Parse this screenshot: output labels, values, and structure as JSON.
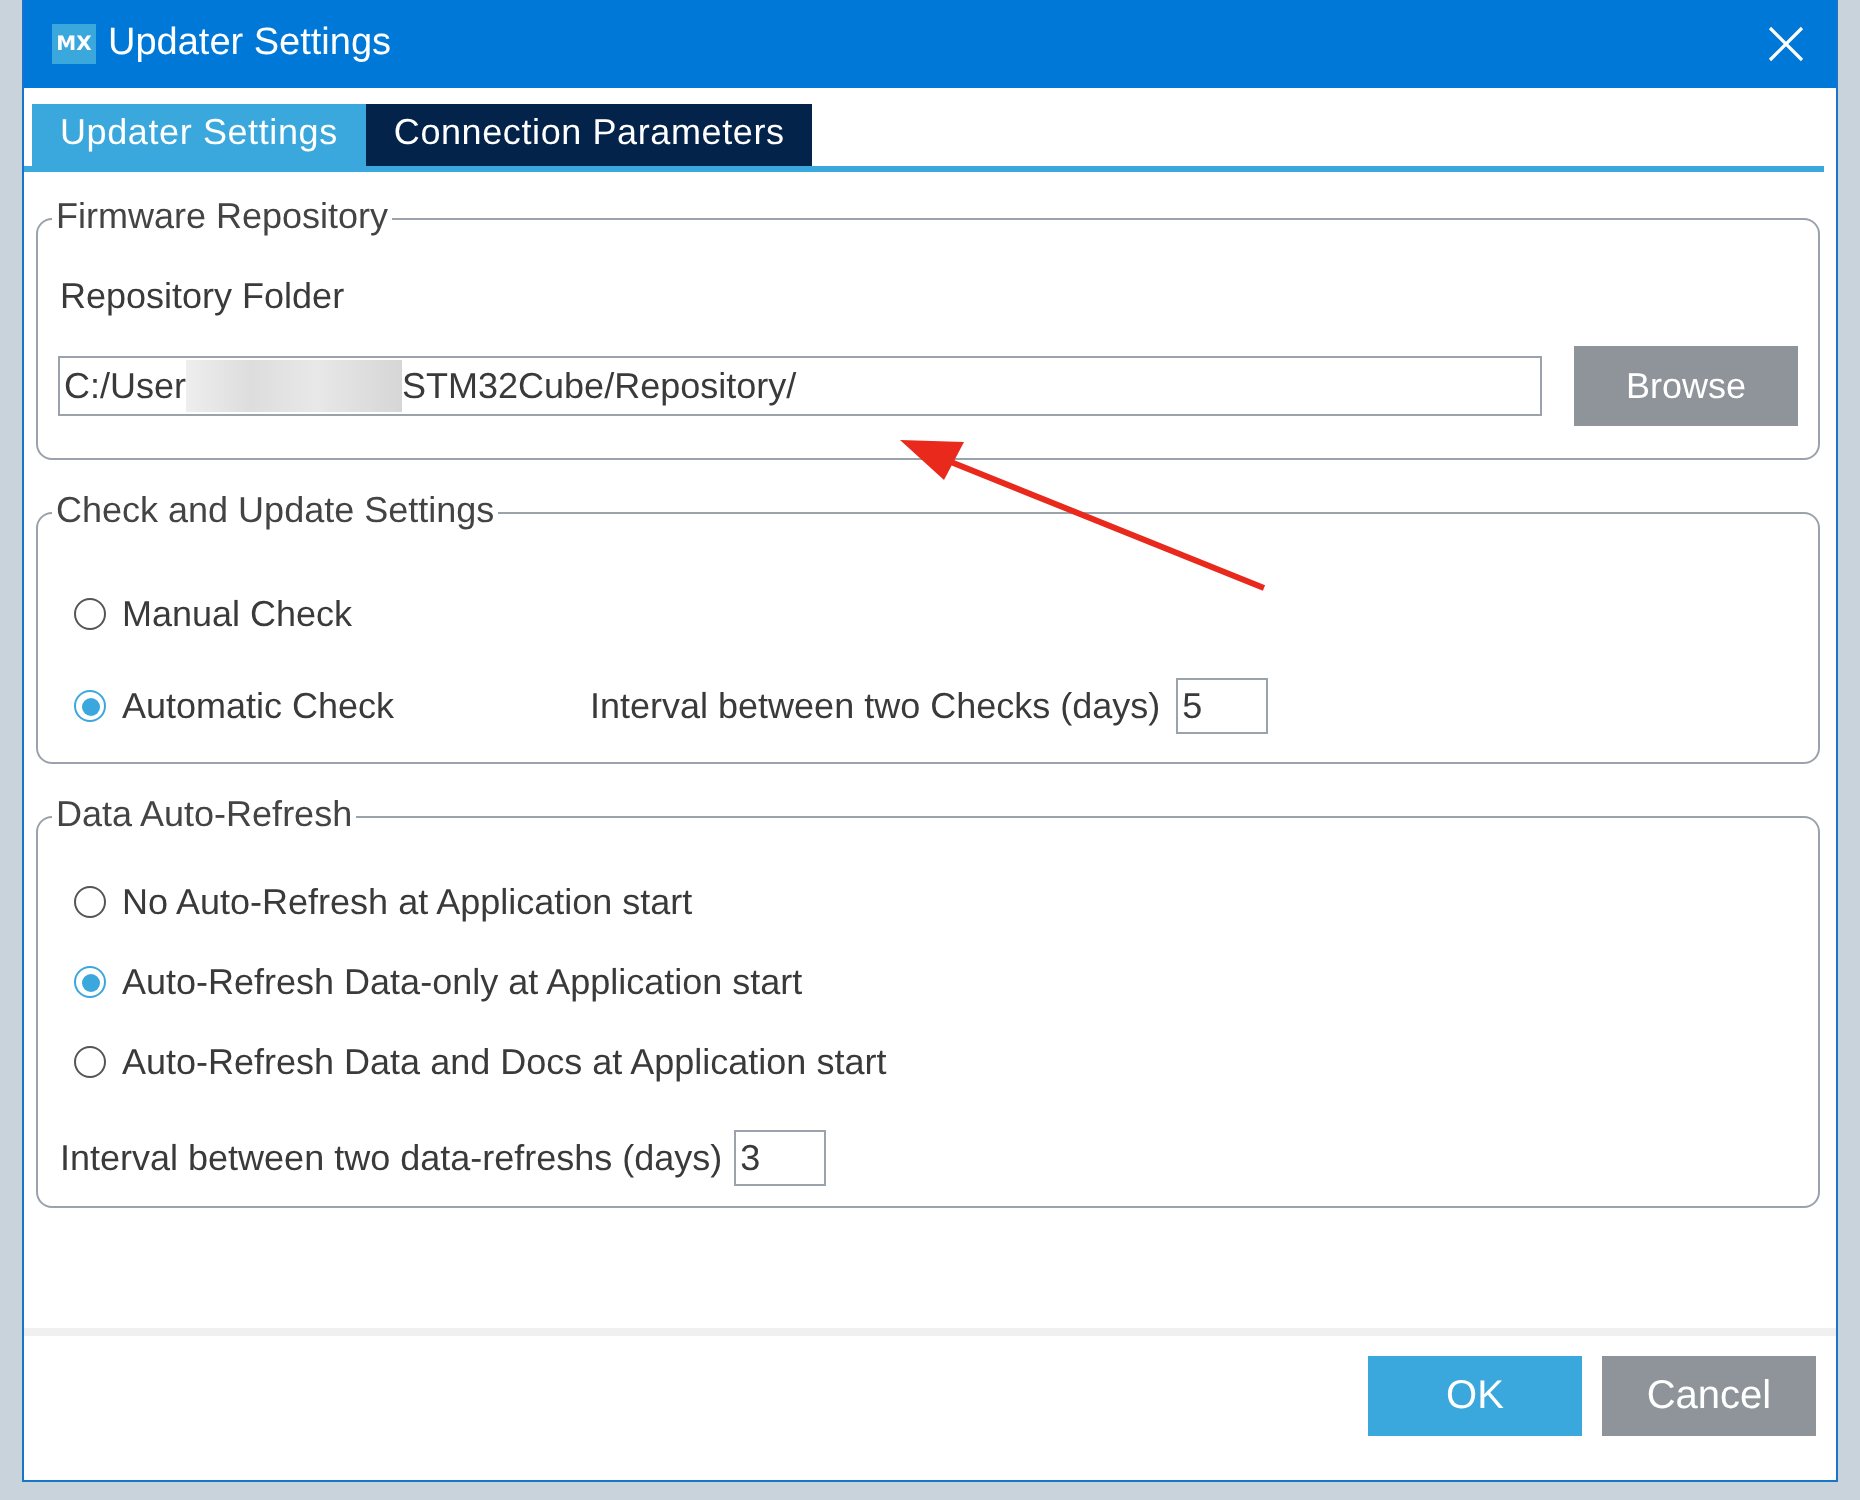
{
  "window": {
    "logo": "MX",
    "title": "Updater Settings"
  },
  "tabs": [
    {
      "label": "Updater Settings",
      "selected": true
    },
    {
      "label": "Connection Parameters",
      "selected": false
    }
  ],
  "firmware_repository": {
    "title": "Firmware Repository",
    "label": "Repository Folder",
    "value_parts": [
      "C:/User",
      "STM32Cube/Repository/"
    ],
    "browse": "Browse"
  },
  "check_and_update": {
    "title": "Check and Update Settings",
    "options": [
      {
        "label": "Manual Check",
        "selected": false
      },
      {
        "label": "Automatic Check",
        "selected": true
      }
    ],
    "interval_label": "Interval between two Checks (days)",
    "interval_value": "5"
  },
  "data_auto_refresh": {
    "title": "Data Auto-Refresh",
    "options": [
      {
        "label": "No Auto-Refresh at Application start",
        "selected": false
      },
      {
        "label": "Auto-Refresh Data-only at Application start",
        "selected": true
      },
      {
        "label": "Auto-Refresh Data and Docs at Application start",
        "selected": false
      }
    ],
    "interval_label": "Interval between two data-refreshs (days)",
    "interval_value": "3"
  },
  "buttons": [
    "OK",
    "Cancel"
  ]
}
